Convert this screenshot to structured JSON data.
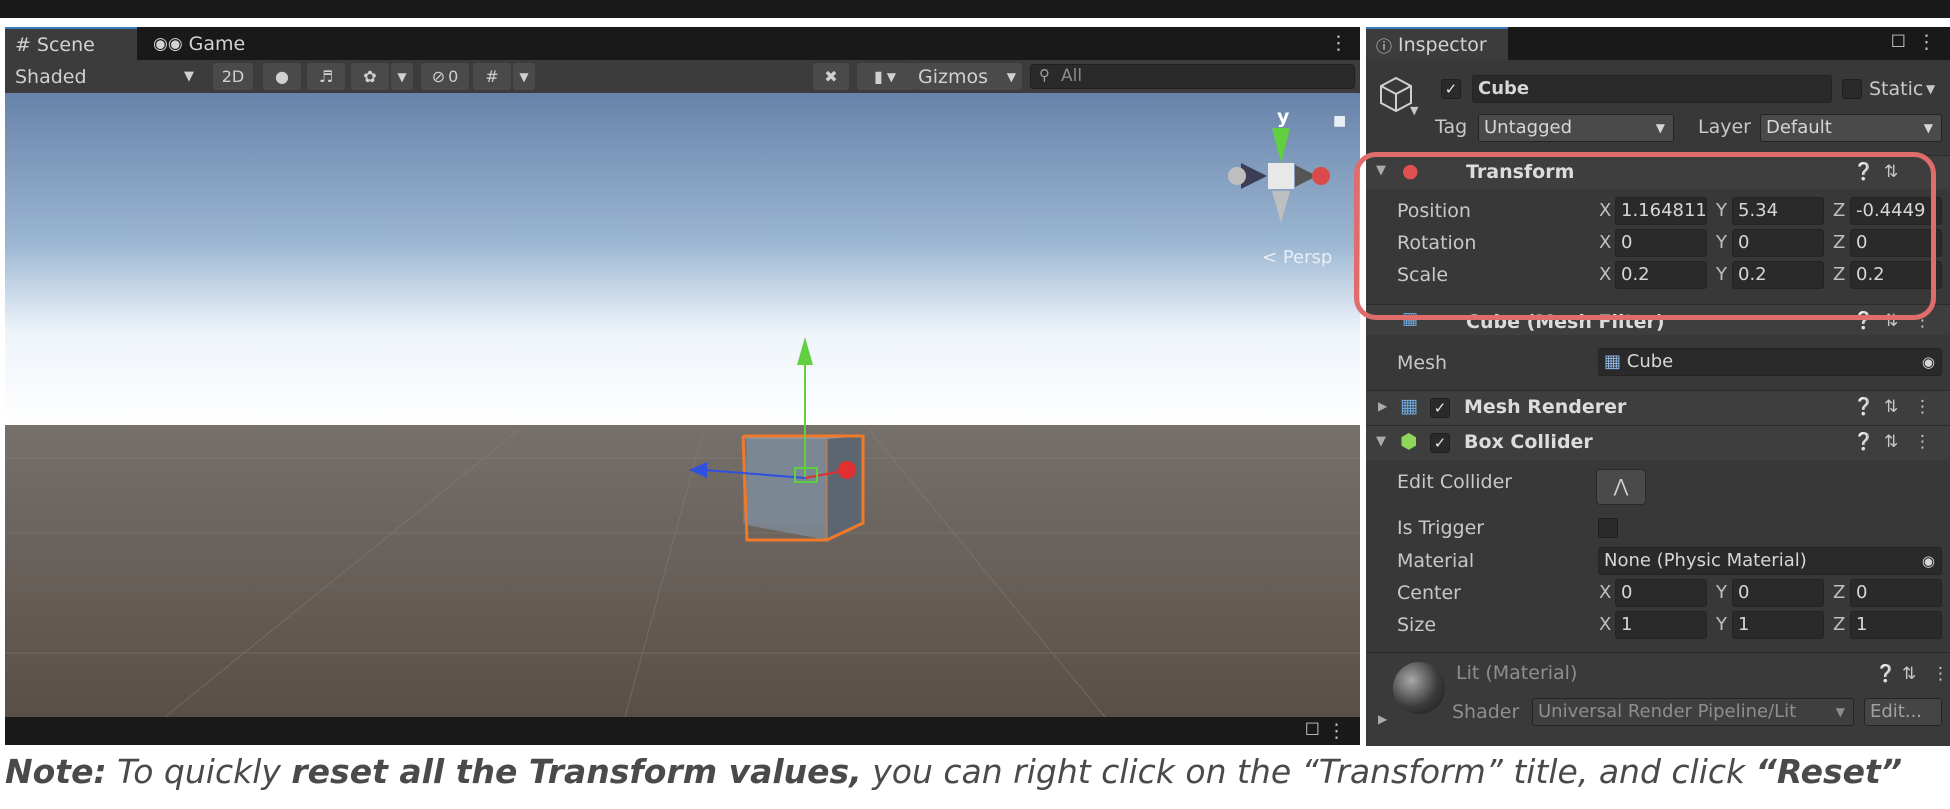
{
  "scene_window": {
    "tabs": [
      {
        "icon": "hash-icon",
        "label": "Scene"
      },
      {
        "icon": "gamepad-icon",
        "label": "Game"
      }
    ],
    "toolbar": {
      "shading_mode": "Shaded",
      "mode_2d": "2D",
      "hidden_count": "0",
      "gizmos_label": "Gizmos",
      "search_placeholder": "All"
    },
    "orientation_gizmo": {
      "axis_label": "y",
      "projection_label": "Persp"
    }
  },
  "inspector": {
    "tab_label": "Inspector",
    "object": {
      "name": "Cube",
      "active": true,
      "static_label": "Static",
      "tag_label": "Tag",
      "tag_value": "Untagged",
      "layer_label": "Layer",
      "layer_value": "Default"
    },
    "transform": {
      "title": "Transform",
      "rows": [
        {
          "label": "Position",
          "x": "1.164811",
          "y": "5.34",
          "z": "-0.4449"
        },
        {
          "label": "Rotation",
          "x": "0",
          "y": "0",
          "z": "0"
        },
        {
          "label": "Scale",
          "x": "0.2",
          "y": "0.2",
          "z": "0.2"
        }
      ],
      "axis_labels": {
        "x": "X",
        "y": "Y",
        "z": "Z"
      }
    },
    "mesh_filter": {
      "title": "Cube (Mesh Filter)",
      "mesh_label": "Mesh",
      "mesh_value": "Cube"
    },
    "mesh_renderer": {
      "title": "Mesh Renderer",
      "enabled": true
    },
    "box_collider": {
      "title": "Box Collider",
      "enabled": true,
      "edit_collider_label": "Edit Collider",
      "is_trigger_label": "Is Trigger",
      "material_label": "Material",
      "material_value": "None (Physic Material)",
      "center_label": "Center",
      "center": {
        "x": "0",
        "y": "0",
        "z": "0"
      },
      "size_label": "Size",
      "size": {
        "x": "1",
        "y": "1",
        "z": "1"
      }
    },
    "material": {
      "title": "Lit (Material)",
      "shader_label": "Shader",
      "shader_value": "Universal Render Pipeline/Lit",
      "edit_label": "Edit..."
    }
  },
  "note": {
    "lead": "Note:",
    "text1": " To quickly ",
    "bold1": "reset all the Transform values,",
    "text2": " you can right click on the “Transform” title, and click ",
    "bold2": "“Reset”"
  },
  "colors": {
    "highlight_outline": "#e06c6c",
    "selection_orange": "#f07a2a",
    "x_axis": "#e03030",
    "y_axis": "#60d040",
    "z_axis": "#3050e0",
    "tab_accent": "#3a79bb"
  }
}
